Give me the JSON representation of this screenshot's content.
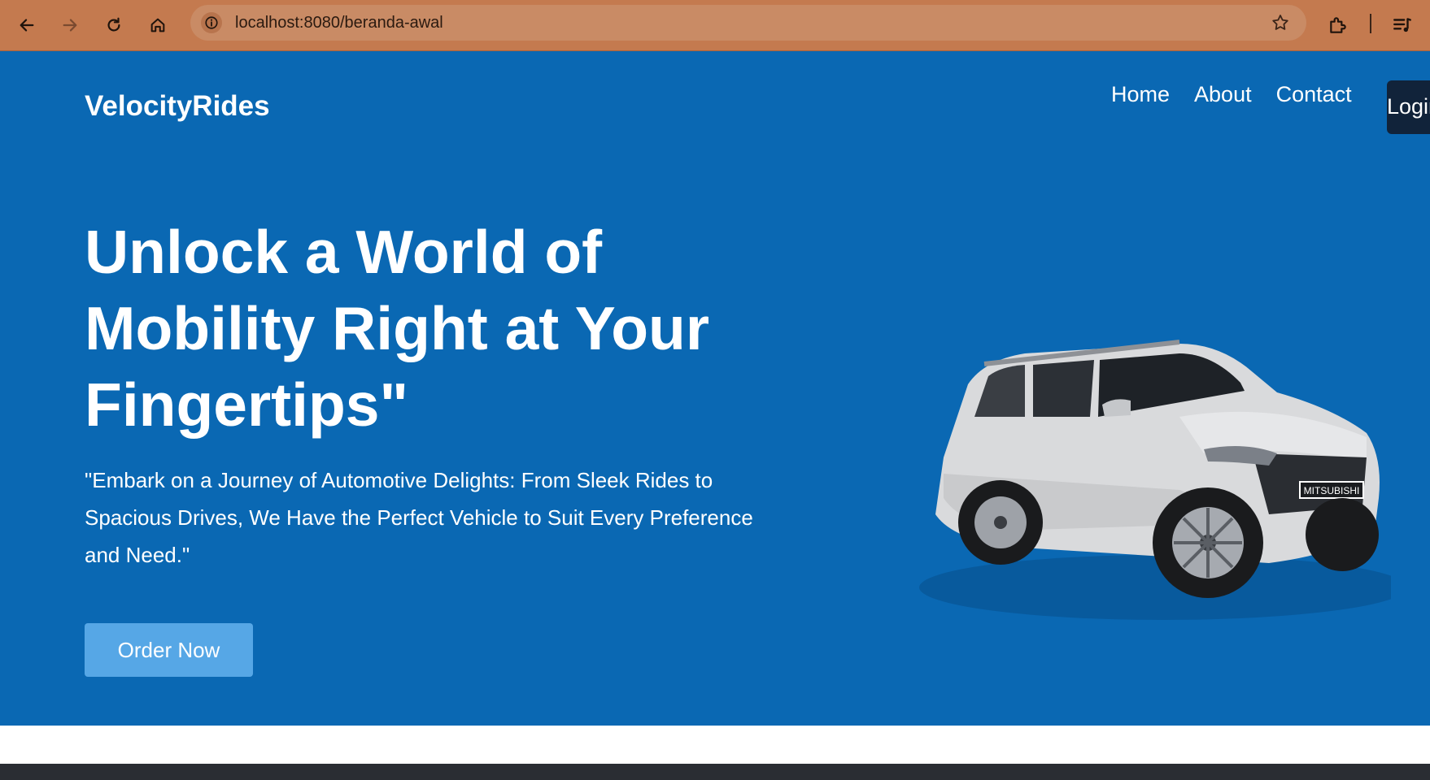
{
  "browser": {
    "url": "localhost:8080/beranda-awal",
    "icons": [
      "back-icon",
      "forward-icon",
      "reload-icon",
      "home-icon",
      "info-icon",
      "star-icon",
      "extensions-icon",
      "media-icon"
    ],
    "chrome_color": "#c47a4f"
  },
  "site": {
    "brand": "VelocityRides",
    "nav": [
      "Home",
      "About",
      "Contact"
    ],
    "login_label": "Login",
    "headline": "Unlock a World of Mobility Right at Your Fingertips\"",
    "subtext": "\"Embark on a Journey of Automotive Delights: From Sleek Rides to Spacious Drives, We Have the Perfect Vehicle to Suit Every Preference and Need.\"",
    "cta_label": "Order Now",
    "car_plate": "MITSUBISHI",
    "colors": {
      "hero_bg": "#0a68b3",
      "cta_bg": "#56a7e6",
      "login_bg": "#11233a"
    }
  }
}
